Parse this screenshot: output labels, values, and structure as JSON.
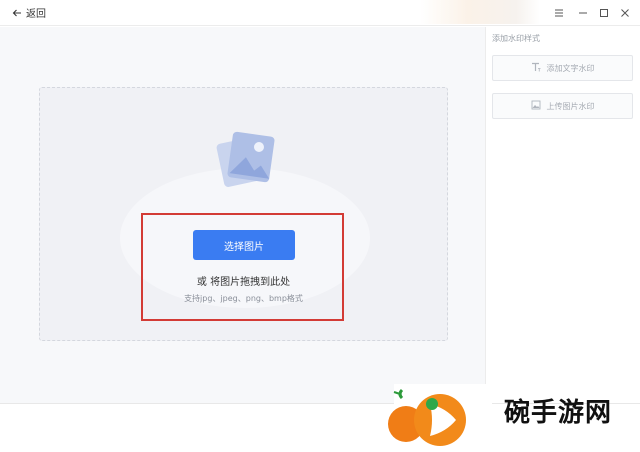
{
  "titlebar": {
    "back_label": "返回",
    "icons": [
      "back-arrow-icon",
      "menu-icon",
      "minimize-icon",
      "maximize-icon",
      "close-icon"
    ]
  },
  "upload": {
    "select_button": "选择图片",
    "drag_hint": "或 将图片拖拽到此处",
    "formats": "支持jpg、jpeg、png、bmp格式",
    "accent_color": "#3a7cf2",
    "highlight_color": "#d33b35"
  },
  "sidebar": {
    "title": "添加水印样式",
    "buttons": [
      {
        "label": "添加文字水印",
        "icon": "text-icon"
      },
      {
        "label": "上传图片水印",
        "icon": "image-icon"
      }
    ]
  },
  "watermark": {
    "text": "碗手游网",
    "icon": "orange-play-logo-icon"
  }
}
